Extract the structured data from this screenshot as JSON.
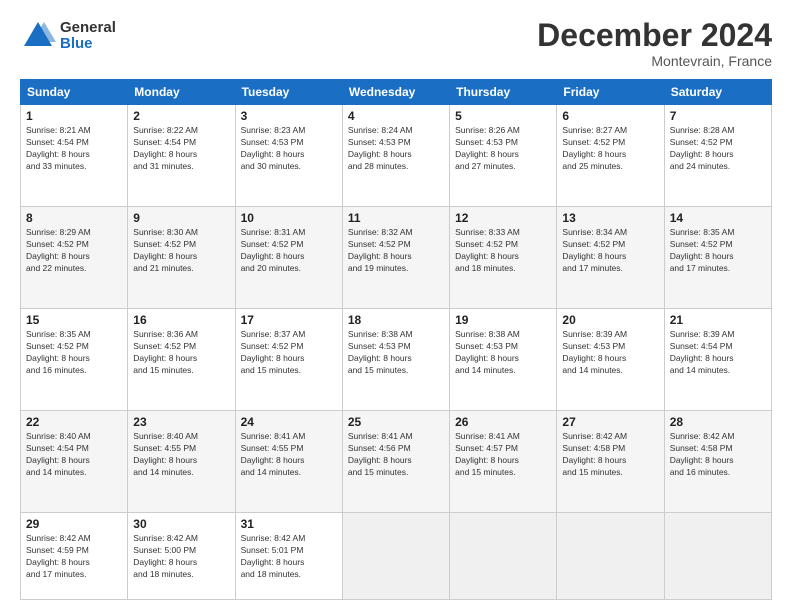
{
  "header": {
    "logo_general": "General",
    "logo_blue": "Blue",
    "month_title": "December 2024",
    "location": "Montevrain, France"
  },
  "calendar": {
    "days_of_week": [
      "Sunday",
      "Monday",
      "Tuesday",
      "Wednesday",
      "Thursday",
      "Friday",
      "Saturday"
    ],
    "weeks": [
      [
        {
          "num": "",
          "info": ""
        },
        {
          "num": "2",
          "info": "Sunrise: 8:22 AM\nSunset: 4:54 PM\nDaylight: 8 hours\nand 31 minutes."
        },
        {
          "num": "3",
          "info": "Sunrise: 8:23 AM\nSunset: 4:53 PM\nDaylight: 8 hours\nand 30 minutes."
        },
        {
          "num": "4",
          "info": "Sunrise: 8:24 AM\nSunset: 4:53 PM\nDaylight: 8 hours\nand 28 minutes."
        },
        {
          "num": "5",
          "info": "Sunrise: 8:26 AM\nSunset: 4:53 PM\nDaylight: 8 hours\nand 27 minutes."
        },
        {
          "num": "6",
          "info": "Sunrise: 8:27 AM\nSunset: 4:52 PM\nDaylight: 8 hours\nand 25 minutes."
        },
        {
          "num": "7",
          "info": "Sunrise: 8:28 AM\nSunset: 4:52 PM\nDaylight: 8 hours\nand 24 minutes."
        }
      ],
      [
        {
          "num": "8",
          "info": "Sunrise: 8:29 AM\nSunset: 4:52 PM\nDaylight: 8 hours\nand 22 minutes."
        },
        {
          "num": "9",
          "info": "Sunrise: 8:30 AM\nSunset: 4:52 PM\nDaylight: 8 hours\nand 21 minutes."
        },
        {
          "num": "10",
          "info": "Sunrise: 8:31 AM\nSunset: 4:52 PM\nDaylight: 8 hours\nand 20 minutes."
        },
        {
          "num": "11",
          "info": "Sunrise: 8:32 AM\nSunset: 4:52 PM\nDaylight: 8 hours\nand 19 minutes."
        },
        {
          "num": "12",
          "info": "Sunrise: 8:33 AM\nSunset: 4:52 PM\nDaylight: 8 hours\nand 18 minutes."
        },
        {
          "num": "13",
          "info": "Sunrise: 8:34 AM\nSunset: 4:52 PM\nDaylight: 8 hours\nand 17 minutes."
        },
        {
          "num": "14",
          "info": "Sunrise: 8:35 AM\nSunset: 4:52 PM\nDaylight: 8 hours\nand 17 minutes."
        }
      ],
      [
        {
          "num": "15",
          "info": "Sunrise: 8:35 AM\nSunset: 4:52 PM\nDaylight: 8 hours\nand 16 minutes."
        },
        {
          "num": "16",
          "info": "Sunrise: 8:36 AM\nSunset: 4:52 PM\nDaylight: 8 hours\nand 15 minutes."
        },
        {
          "num": "17",
          "info": "Sunrise: 8:37 AM\nSunset: 4:52 PM\nDaylight: 8 hours\nand 15 minutes."
        },
        {
          "num": "18",
          "info": "Sunrise: 8:38 AM\nSunset: 4:53 PM\nDaylight: 8 hours\nand 15 minutes."
        },
        {
          "num": "19",
          "info": "Sunrise: 8:38 AM\nSunset: 4:53 PM\nDaylight: 8 hours\nand 14 minutes."
        },
        {
          "num": "20",
          "info": "Sunrise: 8:39 AM\nSunset: 4:53 PM\nDaylight: 8 hours\nand 14 minutes."
        },
        {
          "num": "21",
          "info": "Sunrise: 8:39 AM\nSunset: 4:54 PM\nDaylight: 8 hours\nand 14 minutes."
        }
      ],
      [
        {
          "num": "22",
          "info": "Sunrise: 8:40 AM\nSunset: 4:54 PM\nDaylight: 8 hours\nand 14 minutes."
        },
        {
          "num": "23",
          "info": "Sunrise: 8:40 AM\nSunset: 4:55 PM\nDaylight: 8 hours\nand 14 minutes."
        },
        {
          "num": "24",
          "info": "Sunrise: 8:41 AM\nSunset: 4:55 PM\nDaylight: 8 hours\nand 14 minutes."
        },
        {
          "num": "25",
          "info": "Sunrise: 8:41 AM\nSunset: 4:56 PM\nDaylight: 8 hours\nand 15 minutes."
        },
        {
          "num": "26",
          "info": "Sunrise: 8:41 AM\nSunset: 4:57 PM\nDaylight: 8 hours\nand 15 minutes."
        },
        {
          "num": "27",
          "info": "Sunrise: 8:42 AM\nSunset: 4:58 PM\nDaylight: 8 hours\nand 15 minutes."
        },
        {
          "num": "28",
          "info": "Sunrise: 8:42 AM\nSunset: 4:58 PM\nDaylight: 8 hours\nand 16 minutes."
        }
      ],
      [
        {
          "num": "29",
          "info": "Sunrise: 8:42 AM\nSunset: 4:59 PM\nDaylight: 8 hours\nand 17 minutes."
        },
        {
          "num": "30",
          "info": "Sunrise: 8:42 AM\nSunset: 5:00 PM\nDaylight: 8 hours\nand 18 minutes."
        },
        {
          "num": "31",
          "info": "Sunrise: 8:42 AM\nSunset: 5:01 PM\nDaylight: 8 hours\nand 18 minutes."
        },
        {
          "num": "",
          "info": ""
        },
        {
          "num": "",
          "info": ""
        },
        {
          "num": "",
          "info": ""
        },
        {
          "num": "",
          "info": ""
        }
      ]
    ],
    "first_day_num": "1",
    "first_day_info": "Sunrise: 8:21 AM\nSunset: 4:54 PM\nDaylight: 8 hours\nand 33 minutes."
  }
}
